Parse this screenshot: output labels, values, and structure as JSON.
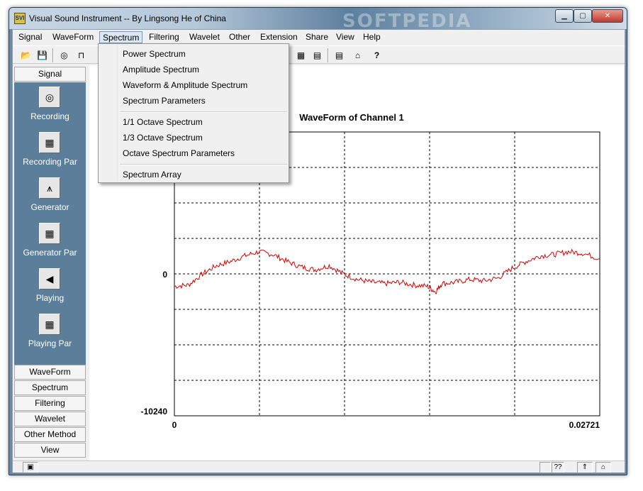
{
  "window": {
    "title": "Visual Sound Instrument -- By Lingsong He of China",
    "icon_text": "SVI",
    "watermark": "SOFTPEDIA",
    "controls": {
      "minimize": "▁",
      "maximize": "▢",
      "close": "✕"
    }
  },
  "menubar": {
    "items": [
      "Signal",
      "WaveForm",
      "Spectrum",
      "Filtering",
      "Wavelet",
      "Other",
      "Extension",
      "Share",
      "View",
      "Help"
    ],
    "active": "Spectrum"
  },
  "toolbar": {
    "icons": [
      "open-folder-icon",
      "save-icon",
      "recording-icon",
      "waveform-icon",
      "spectrum-icon",
      "filter-icon",
      "home-icon",
      "help-icon"
    ],
    "glyphs": [
      "📂",
      "💾",
      "◎",
      "⊓",
      "▦",
      "▤",
      "⌂",
      "?"
    ]
  },
  "dropdown": {
    "groups": [
      [
        "Power Spectrum",
        "Amplitude Spectrum",
        "Waveform & Amplitude Spectrum",
        "Spectrum Parameters"
      ],
      [
        "1/1 Octave Spectrum",
        "1/3 Octave Spectrum",
        "Octave Spectrum Parameters"
      ],
      [
        "Spectrum Array"
      ]
    ]
  },
  "left_panel": {
    "header": "Signal",
    "tools": [
      {
        "label": "Recording",
        "icon": "recording-icon",
        "glyph": "◎"
      },
      {
        "label": "Recording Par",
        "icon": "table-icon",
        "glyph": "▦"
      },
      {
        "label": "Generator",
        "icon": "generator-wave-icon",
        "glyph": "⩚"
      },
      {
        "label": "Generator Par",
        "icon": "table-icon",
        "glyph": "▦"
      },
      {
        "label": "Playing",
        "icon": "speaker-icon",
        "glyph": "◀"
      },
      {
        "label": "Playing Par",
        "icon": "table-icon",
        "glyph": "▦"
      }
    ],
    "sections": [
      "WaveForm",
      "Spectrum",
      "Filtering",
      "Wavelet",
      "Other Method",
      "View"
    ]
  },
  "chart_data": {
    "type": "line",
    "title": "WaveForm of Channel 1",
    "y_tick_labels": [
      "0",
      "-10240"
    ],
    "x_tick_labels": [
      "0",
      "0.02721"
    ],
    "xlim": [
      0,
      0.02721
    ],
    "ylim": [
      -10240,
      10240
    ],
    "grid": true,
    "series": [
      {
        "color": "#e00000",
        "x": [
          0,
          0.0009,
          0.0018,
          0.0027,
          0.0036,
          0.0045,
          0.0054,
          0.0063,
          0.0072,
          0.0081,
          0.009,
          0.0099,
          0.0108,
          0.0117,
          0.0126,
          0.0135,
          0.0144,
          0.0153,
          0.0162,
          0.0167,
          0.0171,
          0.018,
          0.0189,
          0.0198,
          0.0207,
          0.0216,
          0.0225,
          0.0234,
          0.0243,
          0.0252,
          0.0261,
          0.0272
        ],
        "y": [
          -900,
          -800,
          0,
          600,
          900,
          1300,
          1600,
          1400,
          900,
          500,
          300,
          600,
          0,
          -400,
          -600,
          -700,
          -600,
          -800,
          -900,
          -1300,
          -700,
          -600,
          -400,
          -500,
          -300,
          400,
          900,
          1300,
          1400,
          1600,
          1500,
          1100
        ]
      }
    ]
  },
  "statusbar": {
    "cells": [
      "",
      "??",
      "",
      ""
    ],
    "icons": [
      "status-panel-icon",
      "help-status-icon",
      "up-icon",
      "home-icon"
    ]
  }
}
